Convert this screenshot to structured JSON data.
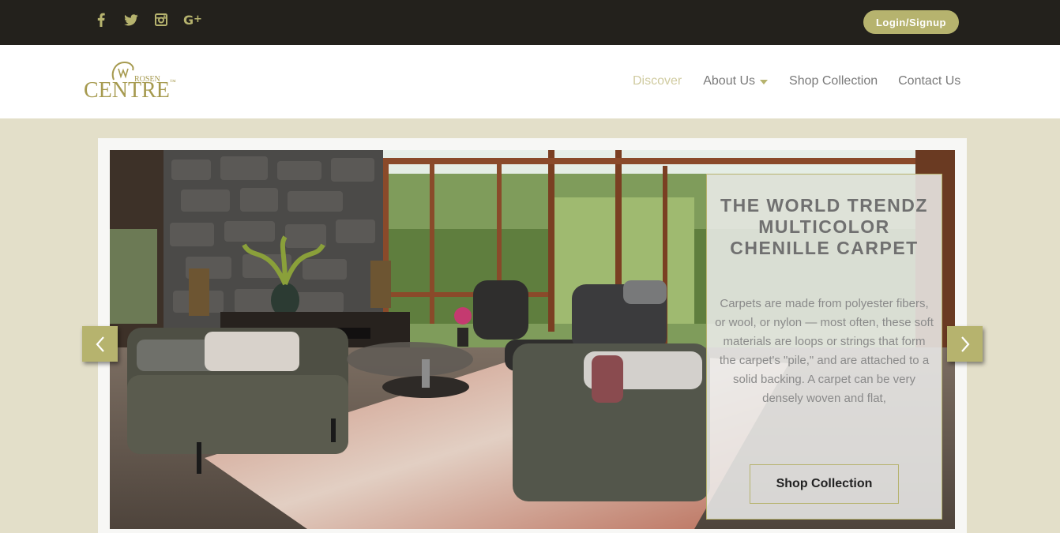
{
  "topbar": {
    "social": [
      {
        "name": "facebook-icon",
        "glyph": "f"
      },
      {
        "name": "twitter-icon",
        "glyph": "twitter"
      },
      {
        "name": "instagram-icon",
        "glyph": "instagram"
      },
      {
        "name": "google-plus-icon",
        "glyph": "G+"
      }
    ],
    "login_label": "Login/Signup"
  },
  "brand": {
    "name": "CENTRE",
    "sub": "ROSEN",
    "tm": "™"
  },
  "nav": {
    "discover": "Discover",
    "about": "About Us",
    "shop": "Shop Collection",
    "contact": "Contact Us"
  },
  "slider": {
    "title": "THE WORLD TRENDZ MULTICOLOR CHENILLE CARPET",
    "description": "Carpets are made from polyester fibers, or wool, or nylon — most often, these soft materials are loops or strings that form the carpet's \"pile,\" and are attached to a solid backing. A carpet can be very densely woven and flat,",
    "button_label": "Shop Collection"
  },
  "colors": {
    "accent": "#b6b36e",
    "topbar_bg": "#23211c",
    "page_bg": "#e3dfc9",
    "nav_active": "#d0cba0"
  }
}
